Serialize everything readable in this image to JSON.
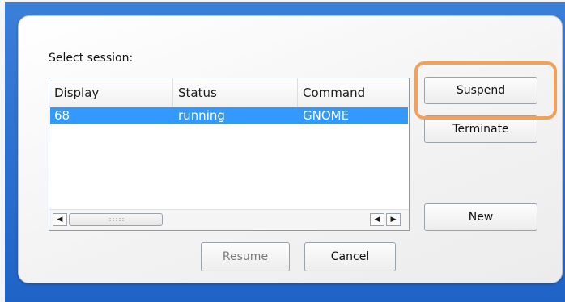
{
  "dialog": {
    "label": "Select session:"
  },
  "session_list": {
    "columns": [
      "Display",
      "Status",
      "Command"
    ],
    "rows": [
      [
        "68",
        "running",
        "GNOME"
      ]
    ]
  },
  "buttons": {
    "suspend": "Suspend",
    "terminate": "Terminate",
    "new": "New",
    "resume": "Resume",
    "cancel": "Cancel"
  },
  "scrollbar": {
    "left_arrow": "◀",
    "right_arrow": "▶"
  },
  "colors": {
    "selection": "#3399ff",
    "highlight": "#f3a05b"
  }
}
